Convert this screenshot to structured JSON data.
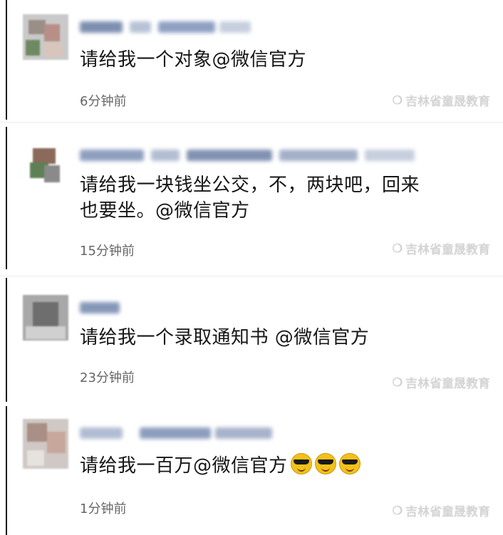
{
  "watermark": {
    "text": "吉林省童晟教育",
    "icon": "wechat-icon"
  },
  "comments": [
    {
      "message": "请给我一个对象@微信官方",
      "time": "6分钟前"
    },
    {
      "message": "请给我一块钱坐公交，不，两块吧，回来\n也要坐。@微信官方",
      "time": "15分钟前"
    },
    {
      "message": "请给我一个录取通知书 @微信官方",
      "time": "23分钟前"
    },
    {
      "message": "请给我一百万@微信官方",
      "time": "1分钟前",
      "emoji_count": 3,
      "emoji": "sunglasses-emoji"
    }
  ]
}
